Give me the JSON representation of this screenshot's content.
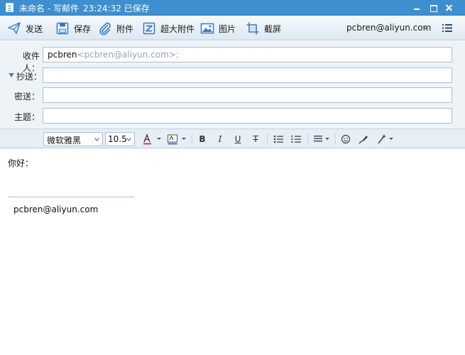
{
  "window": {
    "title": "未命名 - 写邮件",
    "save_status": "23:24:32 已保存"
  },
  "toolbar": {
    "send": "发送",
    "save": "保存",
    "attach": "附件",
    "big_attach": "超大附件",
    "image": "图片",
    "screenshot": "截屏",
    "account": "pcbren@aliyun.com"
  },
  "fields": {
    "to_label": "收件人：",
    "to_name": "pcbren",
    "to_addr": "<pcbren@aliyun.com>;",
    "cc_label": "抄送：",
    "cc_value": "",
    "bcc_label": "密送：",
    "bcc_value": "",
    "subject_label": "主题：",
    "subject_value": ""
  },
  "format": {
    "font": "微软雅黑",
    "size": "10.5",
    "bold": "B",
    "italic": "I",
    "underline": "U",
    "strike": "T"
  },
  "body": {
    "greeting": "你好：",
    "signature": "pcbren@aliyun.com"
  },
  "colors": {
    "titlebar": "#3d8fd0",
    "toolbar_icon": "#3a78c2",
    "accent_red": "#d23a3a"
  }
}
